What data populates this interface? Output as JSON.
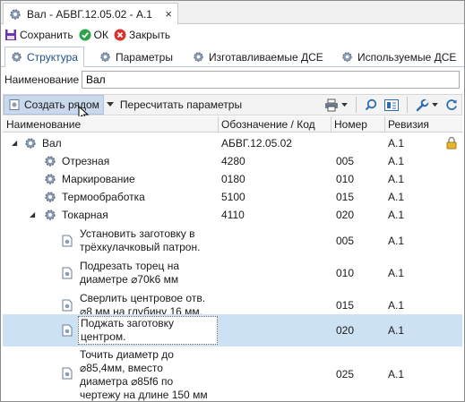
{
  "document_tab": {
    "title": "Вал - АБВГ.12.05.02 - А.1",
    "close": "×"
  },
  "actions": {
    "save": "Сохранить",
    "ok": "ОК",
    "close": "Закрыть"
  },
  "section_tabs": [
    "Структура",
    "Параметры",
    "Изготавливаемые ДСЕ",
    "Используемые ДСЕ"
  ],
  "name_field": {
    "label": "Наименование",
    "value": "Вал"
  },
  "tree_toolbar": {
    "create_near": "Создать рядом",
    "recalc": "Пересчитать параметры"
  },
  "columns": {
    "name": "Наименование",
    "designation": "Обозначение / Код",
    "number": "Номер",
    "revision": "Ревизия"
  },
  "rows": [
    {
      "name": "Вал",
      "code": "АБВГ.12.05.02",
      "number": "",
      "revision": "А.1"
    },
    {
      "name": "Отрезная",
      "code": "4280",
      "number": "005",
      "revision": "А.1"
    },
    {
      "name": "Маркирование",
      "code": "0180",
      "number": "010",
      "revision": "А.1"
    },
    {
      "name": "Термообработка",
      "code": "5100",
      "number": "015",
      "revision": "А.1"
    },
    {
      "name": "Токарная",
      "code": "4110",
      "number": "020",
      "revision": "А.1"
    },
    {
      "name_lines": [
        "Установить заготовку в",
        "трёхкулачковый патрон."
      ],
      "code": "",
      "number": "005",
      "revision": "А.1"
    },
    {
      "name_lines": [
        "Подрезать торец на",
        "диаметре ⌀70k6 мм"
      ],
      "code": "",
      "number": "010",
      "revision": "А.1"
    },
    {
      "name_lines": [
        "Сверлить центровое отв.",
        "⌀8 мм на глубину 16 мм."
      ],
      "code": "",
      "number": "015",
      "revision": "А.1"
    },
    {
      "name_lines": [
        "Поджать заготовку",
        "центром."
      ],
      "code": "",
      "number": "020",
      "revision": "А.1"
    },
    {
      "name_lines": [
        "Точить диаметр до",
        "⌀85,4мм, вместо",
        "диаметра ⌀85f6 по",
        "чертежу на длине 150 мм"
      ],
      "code": "",
      "number": "025",
      "revision": "А.1"
    }
  ]
}
